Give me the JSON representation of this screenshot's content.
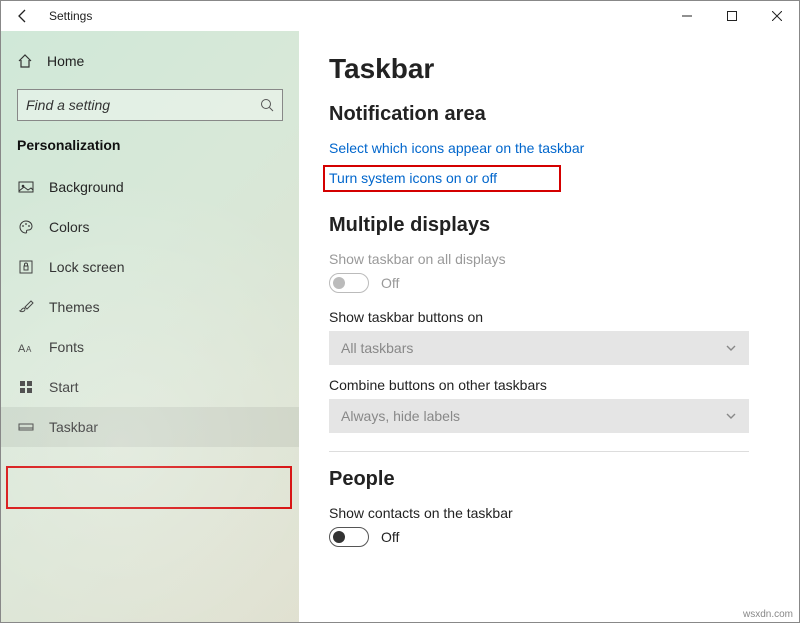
{
  "window_title": "Settings",
  "home_label": "Home",
  "search_placeholder": "Find a setting",
  "category": "Personalization",
  "nav": [
    {
      "id": "background",
      "label": "Background"
    },
    {
      "id": "colors",
      "label": "Colors"
    },
    {
      "id": "lockscreen",
      "label": "Lock screen"
    },
    {
      "id": "themes",
      "label": "Themes"
    },
    {
      "id": "fonts",
      "label": "Fonts"
    },
    {
      "id": "start",
      "label": "Start"
    },
    {
      "id": "taskbar",
      "label": "Taskbar",
      "selected": true
    }
  ],
  "page_title": "Taskbar",
  "notification": {
    "heading": "Notification area",
    "link_icons": "Select which icons appear on the taskbar",
    "link_system": "Turn system icons on or off"
  },
  "displays": {
    "heading": "Multiple displays",
    "all_label": "Show taskbar on all displays",
    "all_state": "Off",
    "buttons_label": "Show taskbar buttons on",
    "buttons_value": "All taskbars",
    "combine_label": "Combine buttons on other taskbars",
    "combine_value": "Always, hide labels"
  },
  "people": {
    "heading": "People",
    "contacts_label": "Show contacts on the taskbar",
    "contacts_state": "Off"
  },
  "watermark": "wsxdn.com"
}
